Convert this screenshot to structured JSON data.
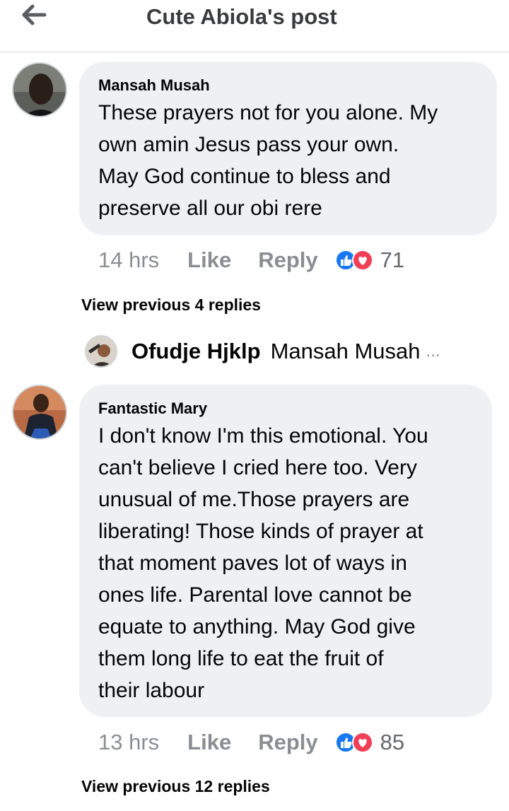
{
  "header": {
    "title": "Cute Abiola's post",
    "back_icon": "arrow-left-icon"
  },
  "comments": [
    {
      "author": "Mansah Musah",
      "text_lines": [
        "These prayers not for you alone. My",
        "own amin Jesus pass your own.",
        "May God continue to bless and",
        "preserve all our obi rere"
      ],
      "time": "14 hrs",
      "like_label": "Like",
      "reply_label": "Reply",
      "reaction_count": "71",
      "reaction_icons": [
        "like-reaction-icon",
        "love-reaction-icon"
      ],
      "view_previous": "View previous 4 replies"
    },
    {
      "author": "Fantastic Mary",
      "text_lines": [
        "I don't know I'm this emotional. You",
        "can't believe I cried here too. Very",
        "unusual of me.Those prayers are",
        "liberating! Those kinds of prayer at",
        "that moment paves lot of ways in",
        "ones life. Parental love cannot be",
        "equate to anything. May God give",
        "them long life to eat the fruit of",
        "their labour"
      ],
      "time": "13 hrs",
      "like_label": "Like",
      "reply_label": "Reply",
      "reaction_count": "85",
      "reaction_icons": [
        "like-reaction-icon",
        "love-reaction-icon"
      ],
      "view_previous": "View previous 12 replies"
    }
  ],
  "reply_preview": {
    "author": "Ofudje Hjklp",
    "text": "Mansah Musah",
    "ellipsis": "..."
  },
  "colors": {
    "bubble": "#eef0f2",
    "meta_text": "#8a8d91",
    "like_blue": "#1877f2",
    "love_red": "#f33e58"
  }
}
